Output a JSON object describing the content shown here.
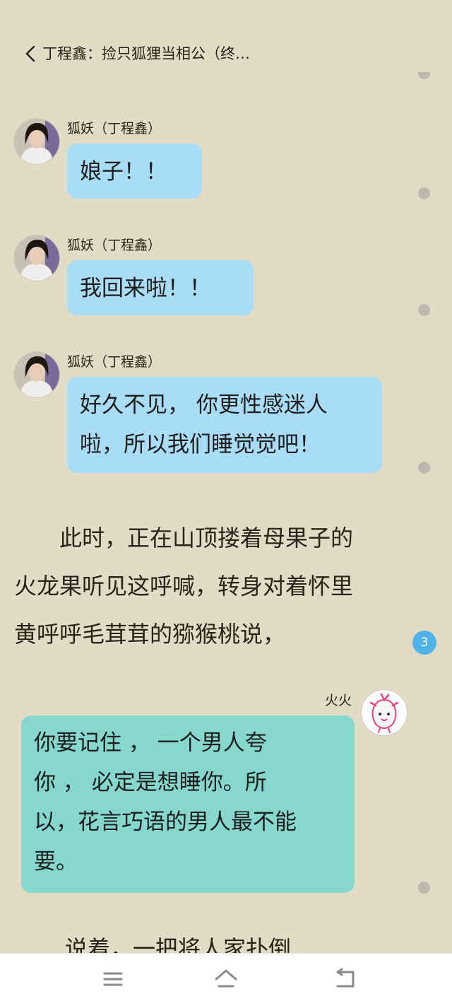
{
  "header": {
    "title": "丁程鑫：捡只狐狸当相公（终…"
  },
  "messages": [
    {
      "sender": "狐妖（丁程鑫）",
      "lines": [
        "娘子！！"
      ]
    },
    {
      "sender": "狐妖（丁程鑫）",
      "lines": [
        "我回来啦！！"
      ]
    },
    {
      "sender": "狐妖（丁程鑫）",
      "lines": [
        "好久不见， 你更性感迷人",
        "啦，所以我们睡觉觉吧！"
      ]
    }
  ],
  "narration": {
    "lines": [
      "　　此时，正在山顶搂着母果子的",
      "火龙果听见这呼喊，转身对着怀里",
      "黄呼呼毛茸茸的猕猴桃说，"
    ],
    "badge": "3"
  },
  "reply": {
    "sender": "火火",
    "lines": [
      "你要记住 ， 一个男人夸",
      "你 ， 必定是想睡你。所",
      "以，花言巧语的男人最不能",
      "要。"
    ]
  },
  "cut_off_text": "说着，一把将人家扑倒",
  "colors": {
    "background": "#e2dcc6",
    "bubble_blue": "#a9dcf6",
    "bubble_teal": "#86d8cf",
    "badge": "#4fb3e8"
  },
  "navbar": {
    "icons": [
      "menu-icon",
      "home-icon",
      "back-icon"
    ]
  }
}
